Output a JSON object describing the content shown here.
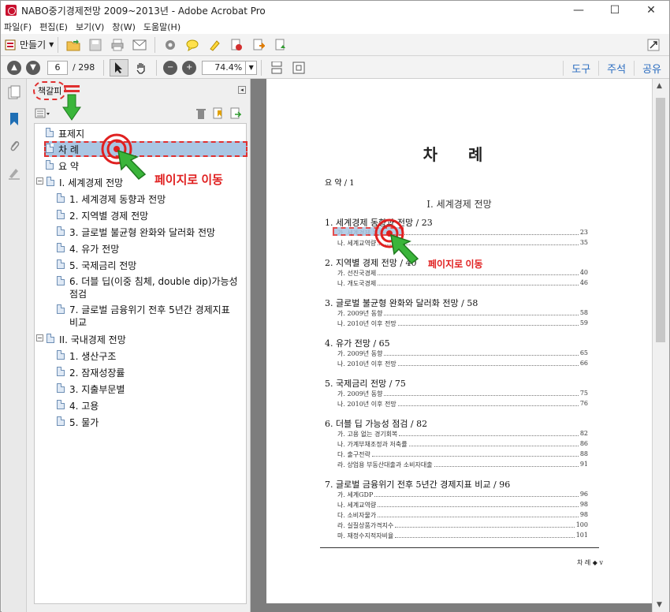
{
  "window": {
    "title": "NABO중기경제전망 2009~2013년 - Adobe Acrobat Pro",
    "minimize": "—",
    "maximize": "☐",
    "close": "✕"
  },
  "menu": [
    "파일(F)",
    "편집(E)",
    "보기(V)",
    "창(W)",
    "도움말(H)"
  ],
  "toolbar": {
    "create_label": "만들기",
    "page_value": "6",
    "page_total": "/ 298",
    "zoom_value": "74.4%",
    "right_links": [
      "도구",
      "주석",
      "공유"
    ]
  },
  "bookmarks": {
    "panel_title": "책갈피",
    "items": [
      {
        "label": "표제지"
      },
      {
        "label": "차 례"
      },
      {
        "label": "요 약"
      },
      {
        "label": "I. 세계경제 전망"
      },
      {
        "label": "1. 세계경제 동향과 전망"
      },
      {
        "label": "2. 지역별 경제 전망"
      },
      {
        "label": "3. 글로벌 불균형 완화와 달러화 전망"
      },
      {
        "label": "4. 유가 전망"
      },
      {
        "label": "5. 국제금리 전망"
      },
      {
        "label": "6. 더블 딥(이중 침체, double dip)가능성 점검"
      },
      {
        "label": "7. 글로벌 금융위기 전후 5년간 경제지표 비교"
      },
      {
        "label": "II. 국내경제 전망"
      },
      {
        "label": "1. 생산구조"
      },
      {
        "label": "2. 잠재성장률"
      },
      {
        "label": "3. 지출부문별"
      },
      {
        "label": "4. 고용"
      },
      {
        "label": "5. 물가"
      }
    ]
  },
  "annotation": {
    "label": "페이지로 이동"
  },
  "document": {
    "title": "차 례",
    "summary": "요 약 / 1",
    "part1": "I. 세계경제 전망",
    "sections": [
      {
        "head": "1. 세계경제 동향과 전망 / 23",
        "subs": [
          {
            "t": "가. 세계경제 동향",
            "n": "23"
          },
          {
            "t": "나. 세계교역량",
            "n": "35"
          }
        ]
      },
      {
        "head": "2. 지역별 경제 전망 / 40",
        "subs": [
          {
            "t": "가. 선진국경제",
            "n": "40"
          },
          {
            "t": "나. 개도국경제",
            "n": "46"
          }
        ]
      },
      {
        "head": "3. 글로벌 불균형 완화와 달러화 전망 / 58",
        "subs": [
          {
            "t": "가. 2009년 동향",
            "n": "58"
          },
          {
            "t": "나. 2010년 이후 전망",
            "n": "59"
          }
        ]
      },
      {
        "head": "4. 유가 전망 / 65",
        "subs": [
          {
            "t": "가. 2009년 동향",
            "n": "65"
          },
          {
            "t": "나. 2010년 이후 전망",
            "n": "66"
          }
        ]
      },
      {
        "head": "5. 국제금리 전망 / 75",
        "subs": [
          {
            "t": "가. 2009년 동향",
            "n": "75"
          },
          {
            "t": "나. 2010년 이후 전망",
            "n": "76"
          }
        ]
      },
      {
        "head": "6. 더블 딥 가능성 점검 / 82",
        "subs": [
          {
            "t": "가. 고용 없는 경기회복",
            "n": "82"
          },
          {
            "t": "나. 가계부채조정과 저축률",
            "n": "86"
          },
          {
            "t": "다. 출구전략",
            "n": "88"
          },
          {
            "t": "라. 상업용 부동산대출과 소비자대출",
            "n": "91"
          }
        ]
      },
      {
        "head": "7. 글로벌 금융위기 전후 5년간 경제지표 비교 / 96",
        "subs": [
          {
            "t": "가. 세계GDP",
            "n": "96"
          },
          {
            "t": "나. 세계교역량",
            "n": "98"
          },
          {
            "t": "다. 소비자물가",
            "n": "98"
          },
          {
            "t": "라. 실질상품가격지수",
            "n": "100"
          },
          {
            "t": "마. 재정수지적자비율",
            "n": "101"
          }
        ]
      }
    ],
    "footer": "차 례 ◆ v"
  }
}
